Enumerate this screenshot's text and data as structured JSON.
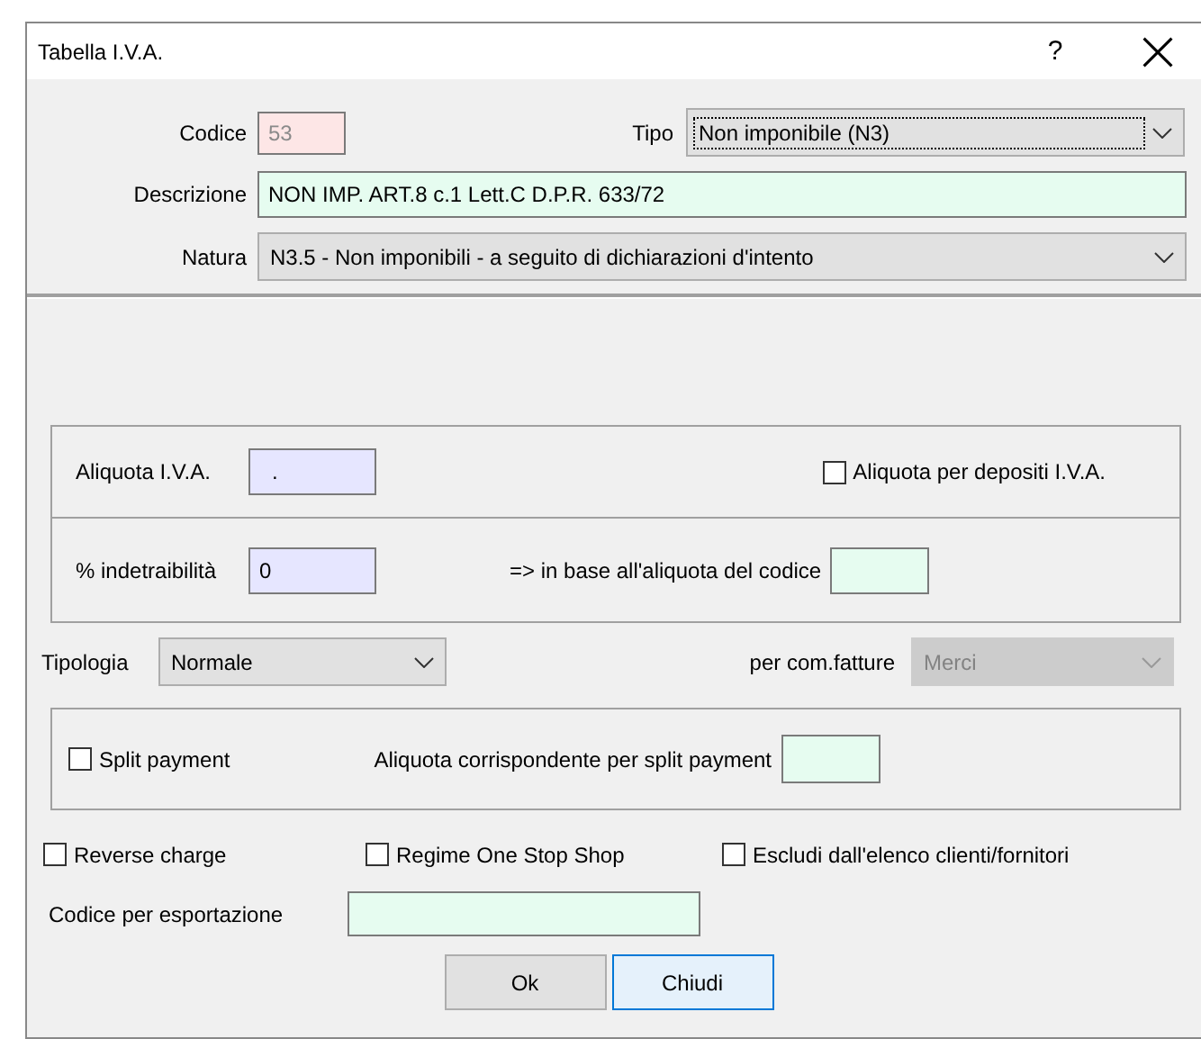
{
  "window": {
    "title": "Tabella I.V.A.",
    "help": "?"
  },
  "codice": {
    "label": "Codice",
    "value": "53",
    "read_only": true
  },
  "tipo": {
    "label": "Tipo",
    "value": "Non imponibile (N3)",
    "focused": true
  },
  "descrizione": {
    "label": "Descrizione",
    "value": "NON IMP. ART.8 c.1 Lett.C D.P.R. 633/72"
  },
  "natura": {
    "label": "Natura",
    "value": "N3.5 - Non imponibili - a seguito di dichiarazioni d'intento"
  },
  "aliquota_iva": {
    "label": "Aliquota I.V.A.",
    "value": "."
  },
  "aliquota_depositi": {
    "label": "Aliquota per depositi I.V.A.",
    "checked": false
  },
  "indetraibilita": {
    "label": "% indetraibilità",
    "value": "0"
  },
  "in_base": {
    "label": "=> in base all'aliquota del codice"
  },
  "tipologia": {
    "label": "Tipologia",
    "value": "Normale",
    "disabled": false
  },
  "per_com_fatture": {
    "label": "per com.fatture",
    "value": "Merci",
    "disabled": true
  },
  "split_payment": {
    "label": "Split payment",
    "checked": false
  },
  "aliquota_split": {
    "label": "Aliquota corrispondente per split payment"
  },
  "options": [
    {
      "label": "Reverse charge",
      "checked": false
    },
    {
      "label": "Regime One Stop Shop",
      "checked": false
    },
    {
      "label": "Escludi dall'elenco clienti/fornitori",
      "checked": false
    }
  ],
  "codice_esportazione": {
    "label": "Codice per esportazione"
  },
  "buttons": [
    {
      "label": "Ok",
      "default": false
    },
    {
      "label": "Chiudi",
      "default": true
    }
  ]
}
